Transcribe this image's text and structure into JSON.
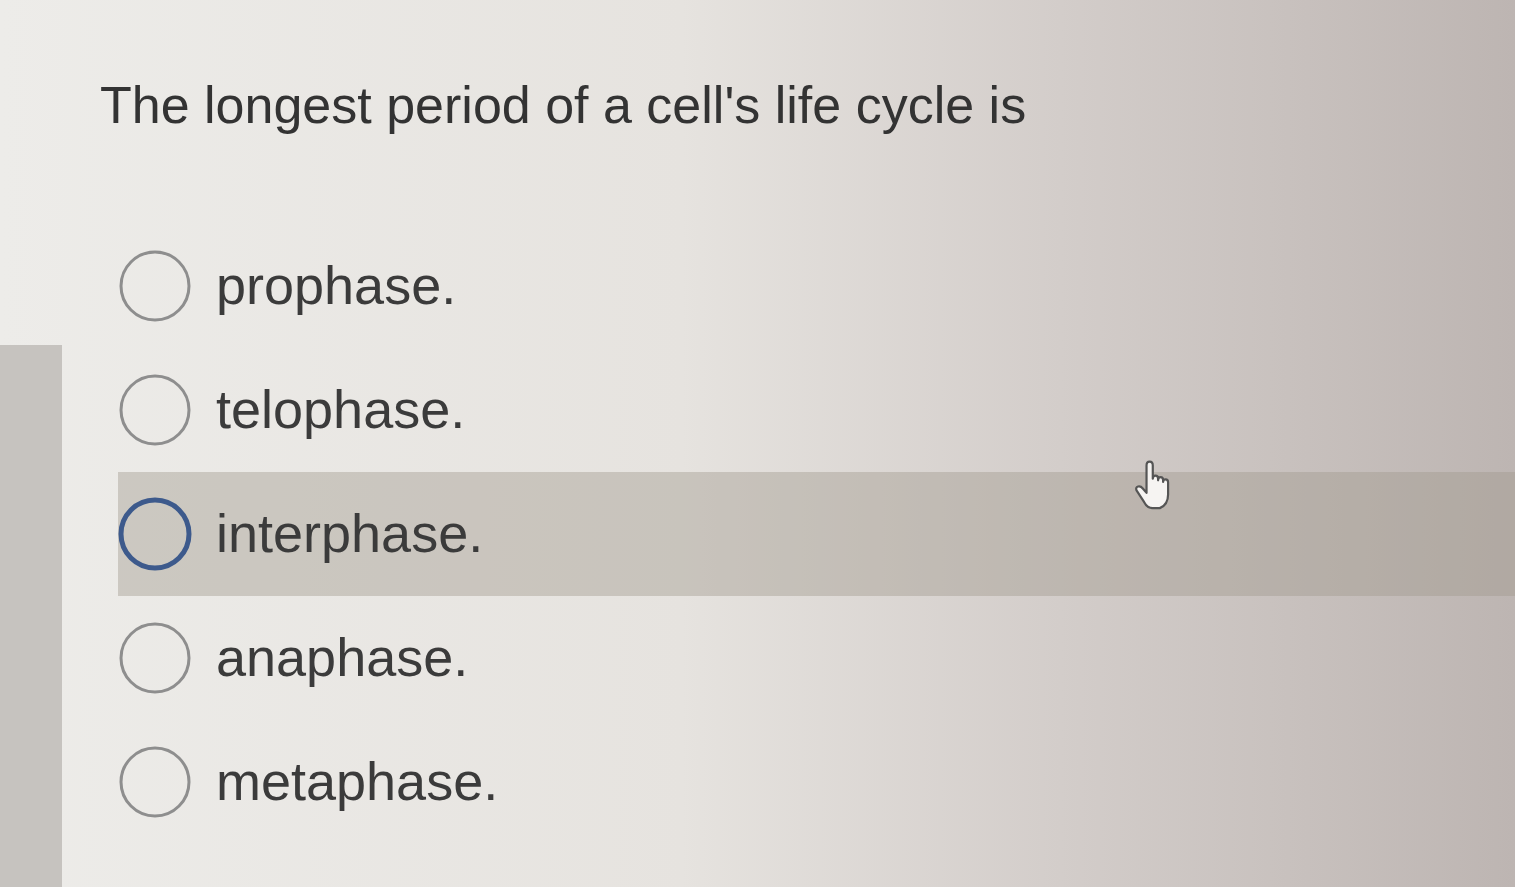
{
  "question": {
    "text": "The longest period of a cell's life cycle is"
  },
  "options": [
    {
      "label": "prophase.",
      "selected": false,
      "highlighted": false
    },
    {
      "label": "telophase.",
      "selected": false,
      "highlighted": false
    },
    {
      "label": "interphase.",
      "selected": false,
      "highlighted": true
    },
    {
      "label": "anaphase.",
      "selected": false,
      "highlighted": false
    },
    {
      "label": "metaphase.",
      "selected": false,
      "highlighted": false
    }
  ]
}
